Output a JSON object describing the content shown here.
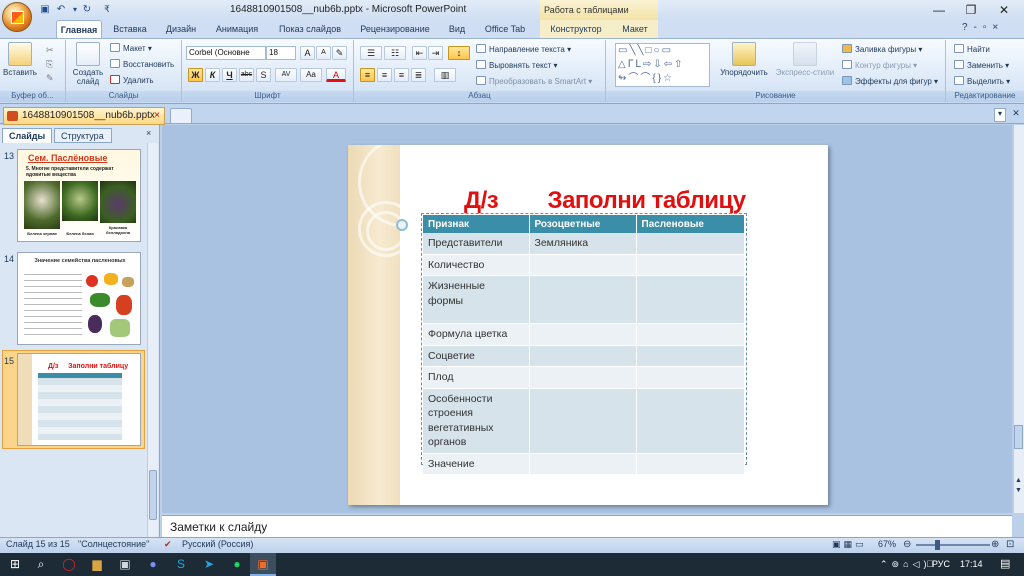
{
  "window": {
    "title": "1648810901508__nub6b.pptx - Microsoft PowerPoint",
    "context_tab_group": "Работа с таблицами"
  },
  "qat": {
    "save_icon": "save-icon",
    "undo_icon": "undo-icon",
    "redo_icon": "redo-icon",
    "customize": "₹"
  },
  "tabs": [
    "Главная",
    "Вставка",
    "Дизайн",
    "Анимация",
    "Показ слайдов",
    "Рецензирование",
    "Вид",
    "Office Tab",
    "Конструктор",
    "Макет"
  ],
  "ribbon": {
    "clipboard": {
      "paste": "Вставить",
      "label": "Буфер об..."
    },
    "slides": {
      "new_slide": "Создать слайд",
      "layout": "Макет",
      "reset": "Восстановить",
      "delete": "Удалить",
      "label": "Слайды"
    },
    "font": {
      "name": "Corbel (Основне",
      "size": "18",
      "label": "Шрифт",
      "bold": "Ж",
      "italic": "К",
      "underline": "Ч",
      "strike": "abc",
      "shadow": "S",
      "spacing": "AV",
      "case": "Aa",
      "color": "A",
      "grow": "A",
      "shrink": "A"
    },
    "paragraph": {
      "text_direction": "Направление текста",
      "align_text": "Выровнять текст",
      "smartart": "Преобразовать в SmartArt",
      "label": "Абзац"
    },
    "drawing": {
      "arrange": "Упорядочить",
      "quick_styles": "Экспресс-стили",
      "fill": "Заливка фигуры",
      "outline": "Контур фигуры",
      "effects": "Эффекты для фигур",
      "label": "Рисование"
    },
    "editing": {
      "find": "Найти",
      "replace": "Заменить",
      "select": "Выделить",
      "label": "Редактирование"
    }
  },
  "doc_tab": {
    "name": "1648810901508__nub6b.pptx"
  },
  "left_pane": {
    "tabs": [
      "Слайды",
      "Структура"
    ],
    "slides": [
      {
        "num": "13",
        "title": "Сем. Паслёновые",
        "subtitle": "5. Многие представители содержат ядовитые вещества",
        "captions": [
          "Белена черная",
          "Белена белая",
          "Красавка белладонна"
        ]
      },
      {
        "num": "14",
        "title": "Значение семейства пасленовых"
      },
      {
        "num": "15",
        "title": "Д/з     Заполни таблицу"
      }
    ]
  },
  "slide": {
    "title": "Д/з        Заполни таблицу",
    "table": {
      "headers": [
        "Признак",
        "Розоцветные",
        "Пасленовые"
      ],
      "rows": [
        [
          "Представители",
          "Земляника",
          ""
        ],
        [
          "Количество",
          "",
          ""
        ],
        [
          "Жизненные формы",
          "",
          ""
        ],
        [
          "Формула цветка",
          "",
          ""
        ],
        [
          "Соцветие",
          "",
          ""
        ],
        [
          "Плод",
          "",
          ""
        ],
        [
          "Особенности строения вегетативных органов",
          "",
          ""
        ],
        [
          "Значение",
          "",
          ""
        ]
      ]
    }
  },
  "notes": {
    "placeholder": "Заметки к слайду"
  },
  "status": {
    "slide_info": "Слайд 15 из 15",
    "theme": "\"Солнцестояние\"",
    "language": "Русский (Россия)",
    "zoom": "67%"
  },
  "taskbar": {
    "lang": "РУС",
    "time": "17:14"
  },
  "colors": {
    "accent": "#3b8ea8",
    "title_red": "#e01010"
  }
}
